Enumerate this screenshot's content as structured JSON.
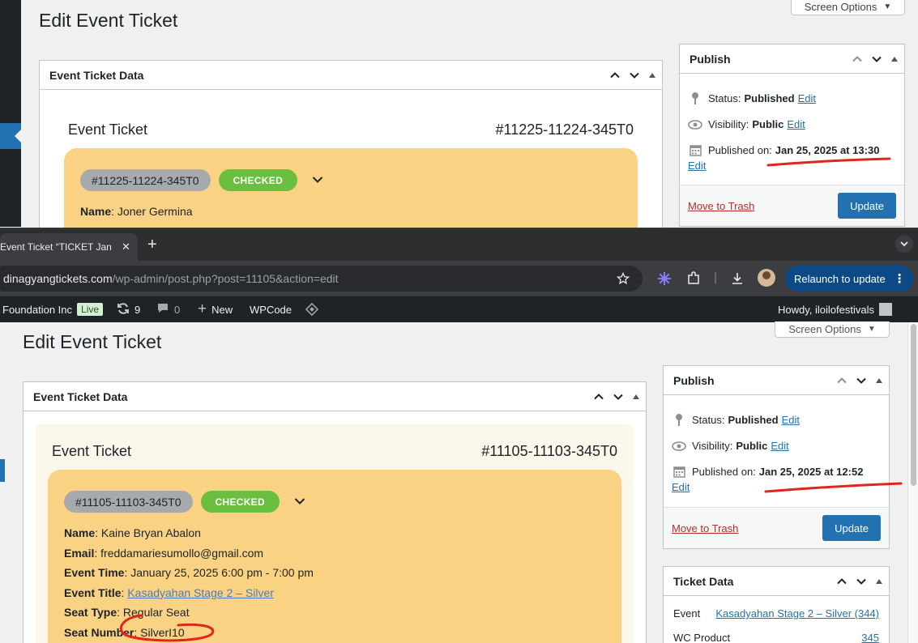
{
  "top": {
    "page_title": "Edit Event Ticket",
    "screen_options": "Screen Options",
    "ticket_box_title": "Event Ticket Data",
    "ticket_label": "Event Ticket",
    "ticket_id": "#11225-11224-345T0",
    "chip_id": "#11225-11224-345T0",
    "chip_status": "CHECKED",
    "fields": [
      {
        "label": "Name",
        "value": "Joner Germina"
      }
    ],
    "publish": {
      "title": "Publish",
      "status_label": "Status:",
      "status_value": "Published",
      "visibility_label": "Visibility:",
      "visibility_value": "Public",
      "published_label": "Published on:",
      "published_value": "Jan 25, 2025 at 13:30",
      "edit": "Edit",
      "trash": "Move to Trash",
      "update": "Update"
    }
  },
  "browser": {
    "tab_title": "Event Ticket “TICKET Jan",
    "url_host": "dinagyangtickets.com",
    "url_path": "/wp-admin/post.php?post=11105&action=edit",
    "relaunch": "Relaunch to update",
    "adminbar": {
      "site": "Foundation Inc",
      "live": "Live",
      "updates": "9",
      "comments": "0",
      "new": "New",
      "wpcode": "WPCode",
      "howdy": "Howdy, iloilofestivals"
    }
  },
  "bottom": {
    "page_title": "Edit Event Ticket",
    "screen_options": "Screen Options",
    "ticket_box_title": "Event Ticket Data",
    "ticket_label": "Event Ticket",
    "ticket_id": "#11105-11103-345T0",
    "chip_id": "#11105-11103-345T0",
    "chip_status": "CHECKED",
    "fields": [
      {
        "label": "Name",
        "value": "Kaine Bryan Abalon"
      },
      {
        "label": "Email",
        "value": "freddamariesumollo@gmail.com"
      },
      {
        "label": "Event Time",
        "value": "January 25, 2025 6:00 pm - 7:00 pm"
      },
      {
        "label": "Event Title",
        "value": "Kasadyahan Stage 2 – Silver"
      },
      {
        "label": "Seat Type",
        "value": "Regular Seat"
      },
      {
        "label": "Seat Number",
        "value": "SilverI10"
      }
    ],
    "publish": {
      "title": "Publish",
      "status_label": "Status:",
      "status_value": "Published",
      "visibility_label": "Visibility:",
      "visibility_value": "Public",
      "published_label": "Published on:",
      "published_value": "Jan 25, 2025 at 12:52",
      "edit": "Edit",
      "trash": "Move to Trash",
      "update": "Update"
    },
    "ticket_data": {
      "title": "Ticket Data",
      "event_label": "Event",
      "event_value": "Kasadyahan Stage 2 – Silver (344)",
      "product_label": "WC Product",
      "product_value": "345"
    }
  },
  "colors": {
    "accent": "#2271b1",
    "checked": "#6abf3e",
    "ticket_bg": "#f9d283",
    "annotation": "#e0261c"
  }
}
